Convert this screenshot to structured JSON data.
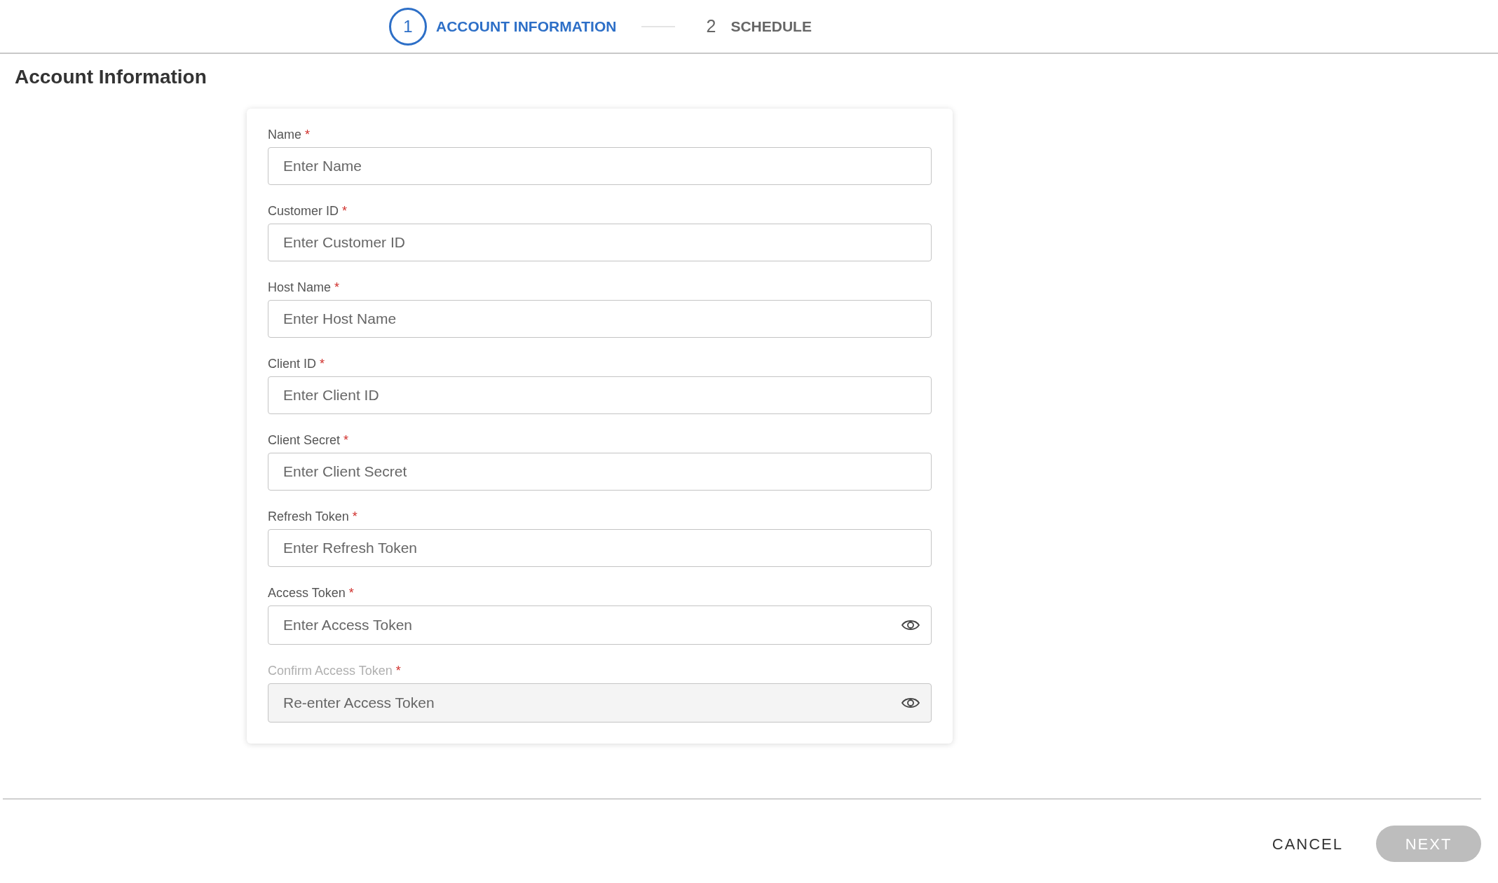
{
  "stepper": {
    "steps": [
      {
        "number": "1",
        "label": "ACCOUNT INFORMATION",
        "selected": true
      },
      {
        "number": "2",
        "label": "SCHEDULE",
        "selected": false
      }
    ]
  },
  "page_title": "Account Information",
  "form": {
    "fields": [
      {
        "kind": "text",
        "label": "Name",
        "required_mark": "*",
        "placeholder": "Enter Name",
        "disabled": false
      },
      {
        "kind": "text",
        "label": "Customer ID",
        "required_mark": "*",
        "placeholder": "Enter Customer ID",
        "disabled": false
      },
      {
        "kind": "text",
        "label": "Host Name",
        "required_mark": "*",
        "placeholder": "Enter Host Name",
        "disabled": false
      },
      {
        "kind": "text",
        "label": "Client ID",
        "required_mark": "*",
        "placeholder": "Enter Client ID",
        "disabled": false
      },
      {
        "kind": "text",
        "label": "Client Secret",
        "required_mark": "*",
        "placeholder": "Enter Client Secret",
        "disabled": false
      },
      {
        "kind": "text",
        "label": "Refresh Token",
        "required_mark": "*",
        "placeholder": "Enter Refresh Token",
        "disabled": false
      },
      {
        "kind": "password",
        "label": "Access Token",
        "required_mark": "*",
        "placeholder": "Enter Access Token",
        "disabled": false
      },
      {
        "kind": "password",
        "label": "Confirm Access Token",
        "required_mark": "*",
        "placeholder": "Re-enter Access Token",
        "disabled": true
      }
    ]
  },
  "footer": {
    "cancel": "CANCEL",
    "next": {
      "label": "NEXT",
      "disabled": true
    }
  }
}
